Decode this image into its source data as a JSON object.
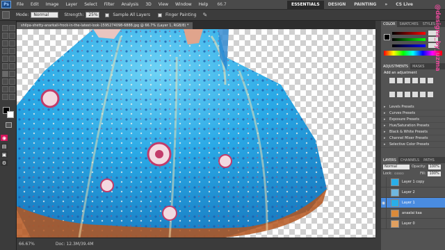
{
  "app": {
    "logo": "Ps"
  },
  "menu": [
    "File",
    "Edit",
    "Image",
    "Layer",
    "Select",
    "Filter",
    "Analysis",
    "3D",
    "View",
    "Window",
    "Help"
  ],
  "zoom_display": "66.7",
  "workspaces": {
    "essentials": "ESSENTIALS",
    "design": "DESIGN",
    "painting": "PAINTING",
    "more": "»",
    "cs_live": "CS Live"
  },
  "options": {
    "mode_label": "Mode:",
    "mode_value": "Normal",
    "strength_label": "Strength:",
    "strength_value": "25%",
    "sample_all": "Sample All Layers",
    "finger_painting": "Finger Painting"
  },
  "document_tab": "shilpa-shetty-anarkali-frock-in-the-latest-look-1595274098-6888.jpg @ 66.7% (Layer 1, RGB/8) *",
  "status": {
    "zoom": "66.67%",
    "doc": "Doc: 12.3M/39.4M"
  },
  "panels": {
    "color_tabs": [
      "COLOR",
      "SWATCHES",
      "STYLES"
    ],
    "adjust_tabs": [
      "ADJUSTMENTS",
      "MASKS"
    ],
    "add_adjustment": "Add an adjustment",
    "presets": [
      "Levels Presets",
      "Curves Presets",
      "Exposure Presets",
      "Hue/Saturation Presets",
      "Black & White Presets",
      "Channel Mixer Presets",
      "Selective Color Presets"
    ],
    "layer_tabs": [
      "LAYERS",
      "CHANNELS",
      "PATHS"
    ],
    "blend_mode": "Normal",
    "opacity_label": "Opacity:",
    "opacity_value": "100%",
    "lock_label": "Lock:",
    "fill_label": "Fill:",
    "fill_value": "100%",
    "layers": [
      {
        "name": "Layer 1 copy"
      },
      {
        "name": "Layer 2"
      },
      {
        "name": "Layer 1",
        "selected": true
      },
      {
        "name": "anaalai kaa"
      },
      {
        "name": "Layer 0"
      }
    ]
  },
  "watermark": "@designs_by_uzma",
  "colors": {
    "dress": "#29aee8",
    "accent": "#e84a9b",
    "selected_layer": "#4a8ce0"
  }
}
